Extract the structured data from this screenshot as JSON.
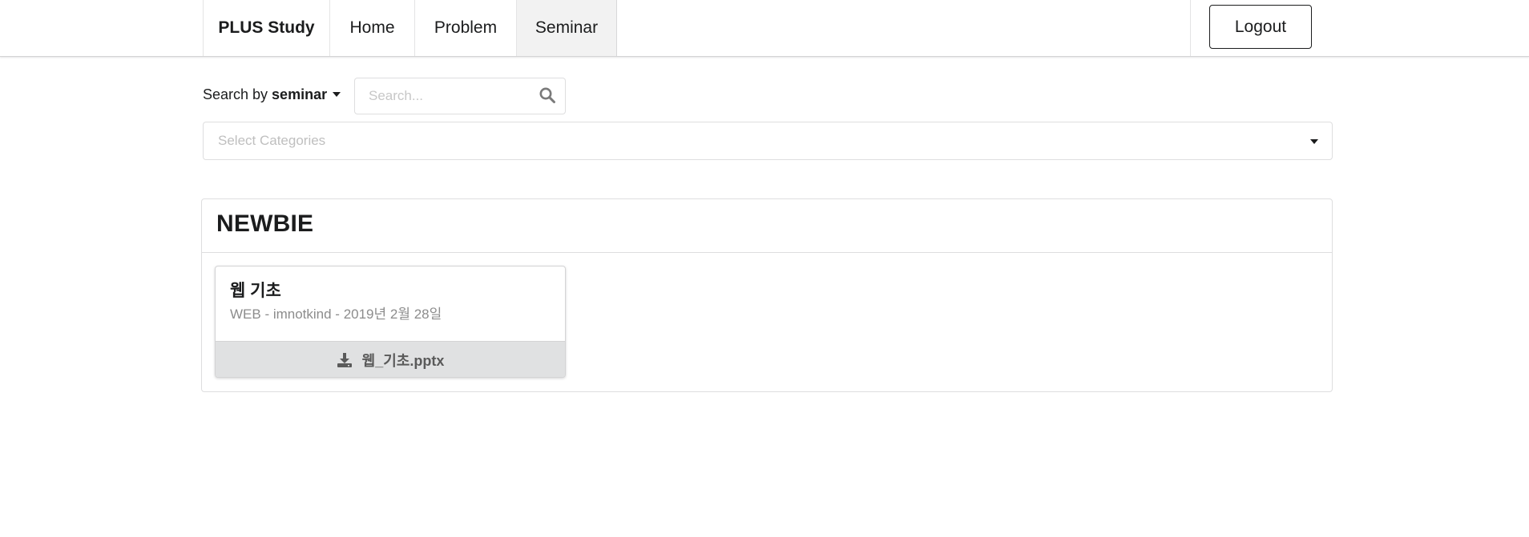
{
  "nav": {
    "brand": "PLUS Study",
    "items": [
      {
        "label": "Home"
      },
      {
        "label": "Problem"
      },
      {
        "label": "Seminar"
      }
    ],
    "logout_label": "Logout"
  },
  "search": {
    "by_label": "Search by",
    "by_value": "seminar",
    "placeholder": "Search...",
    "category_placeholder": "Select Categories"
  },
  "segment": {
    "title": "NEWBIE",
    "cards": [
      {
        "title": "웹 기초",
        "meta": "WEB - imnotkind - 2019년 2월 28일",
        "file": "웹_기초.pptx"
      }
    ]
  },
  "icons": {
    "search": "search-icon",
    "download": "download-icon",
    "dropdown": "caret-down-icon"
  }
}
